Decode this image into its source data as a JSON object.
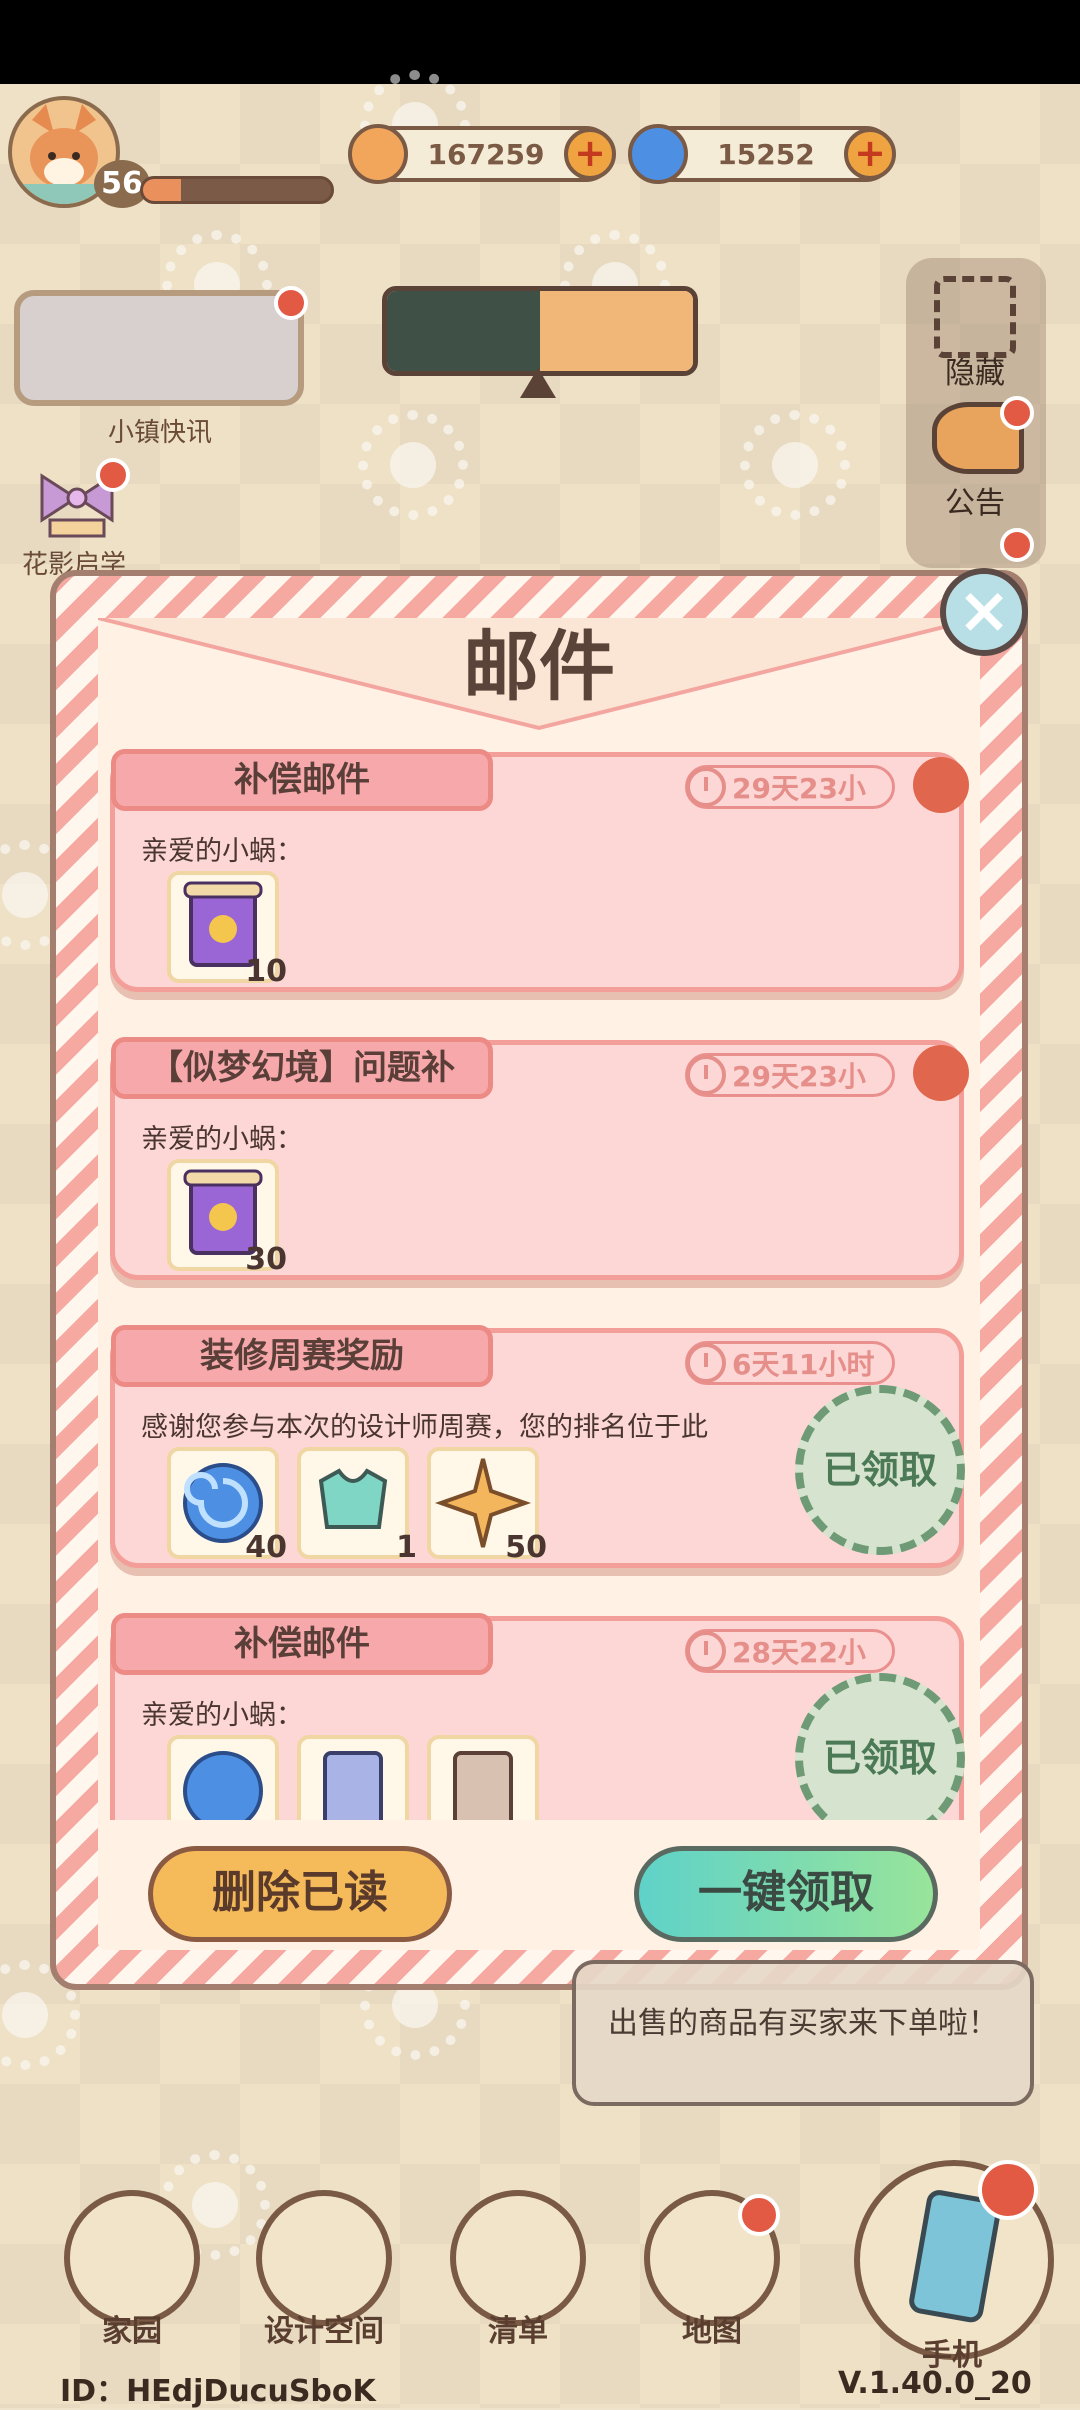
{
  "player": {
    "level": "56",
    "xp_fraction": 0.2
  },
  "currencies": [
    {
      "name": "coin",
      "value": "167259",
      "icon": "coin-icon",
      "color": "#f1a65c"
    },
    {
      "name": "blue-swirl",
      "value": "15252",
      "icon": "blue-swirl-icon",
      "color": "#4d8fe3"
    }
  ],
  "left_widgets": {
    "news_label": "小镇快讯",
    "flower_label": "花影启学"
  },
  "side_buttons": {
    "hide_label": "隐藏",
    "notice_label": "公告"
  },
  "modal": {
    "title": "邮件",
    "mails": [
      {
        "title": "补偿邮件",
        "timer": "29天23小",
        "text": "亲爱的小蜗：",
        "unread": true,
        "claimed": false,
        "items": [
          {
            "icon": "scroll-icon",
            "count": "10"
          }
        ]
      },
      {
        "title": "【似梦幻境】问题补",
        "timer": "29天23小",
        "text": "亲爱的小蜗：",
        "unread": true,
        "claimed": false,
        "items": [
          {
            "icon": "scroll-icon",
            "count": "30"
          }
        ]
      },
      {
        "title": "装修周赛奖励",
        "timer": "6天11小时",
        "text": "感谢您参与本次的设计师周赛，您的排名位于此",
        "unread": false,
        "claimed": true,
        "items": [
          {
            "icon": "blue-swirl-icon",
            "count": "40"
          },
          {
            "icon": "top-clothing-icon",
            "count": "1"
          },
          {
            "icon": "star-icon",
            "count": "50"
          }
        ]
      },
      {
        "title": "补偿邮件",
        "timer": "28天22小",
        "text": "亲爱的小蜗：",
        "unread": false,
        "claimed": true,
        "items": [
          {
            "icon": "blue-swirl-icon",
            "count": ""
          },
          {
            "icon": "blueprint-icon",
            "count": ""
          },
          {
            "icon": "blueprint-icon",
            "count": ""
          }
        ]
      }
    ],
    "claimed_stamp": "已领取",
    "delete_read_label": "删除已读",
    "claim_all_label": "一键领取"
  },
  "toast": {
    "text": "出售的商品有买家来下单啦！"
  },
  "nav": {
    "home": "家园",
    "design": "设计空间",
    "list": "清单",
    "map": "地图",
    "phone": "手机"
  },
  "footer": {
    "id": "ID：HEdjDucuSboK",
    "version": "V.1.40.0_20"
  }
}
